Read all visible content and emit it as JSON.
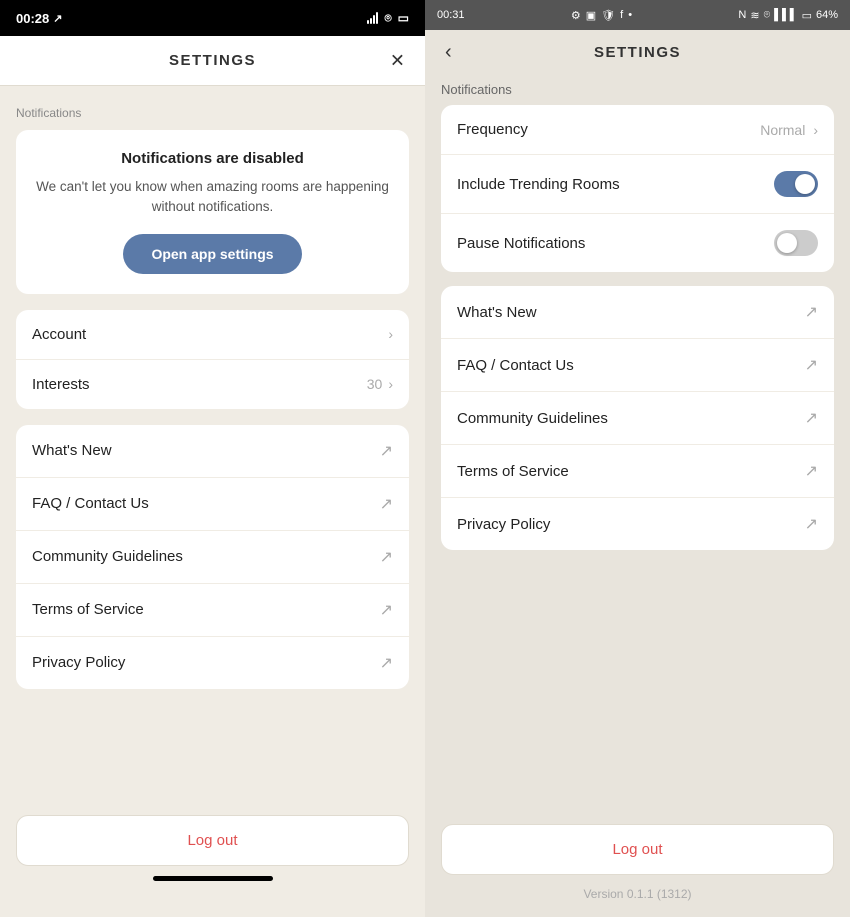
{
  "left": {
    "statusBar": {
      "time": "00:28",
      "locationIcon": "↗"
    },
    "header": {
      "title": "SETTINGS",
      "closeLabel": "✕"
    },
    "notificationsSection": {
      "label": "Notifications",
      "card": {
        "title": "Notifications are disabled",
        "description": "We can't let you know when amazing rooms are happening without notifications.",
        "buttonLabel": "Open app settings"
      }
    },
    "accountSection": {
      "items": [
        {
          "label": "Account",
          "value": "",
          "hasChevron": true
        },
        {
          "label": "Interests",
          "value": "30",
          "hasChevron": true
        }
      ]
    },
    "linksSection": {
      "items": [
        {
          "label": "What's New"
        },
        {
          "label": "FAQ / Contact Us"
        },
        {
          "label": "Community Guidelines"
        },
        {
          "label": "Terms of Service"
        },
        {
          "label": "Privacy Policy"
        }
      ]
    },
    "footer": {
      "logoutLabel": "Log out"
    }
  },
  "right": {
    "statusBar": {
      "time": "00:31",
      "batteryLevel": "64%"
    },
    "header": {
      "title": "SETTINGS",
      "backIcon": "‹"
    },
    "notificationsSection": {
      "label": "Notifications",
      "items": [
        {
          "label": "Frequency",
          "type": "value",
          "value": "Normal"
        },
        {
          "label": "Include Trending Rooms",
          "type": "toggle",
          "on": true
        },
        {
          "label": "Pause Notifications",
          "type": "toggle",
          "on": false
        }
      ]
    },
    "linksSection": {
      "items": [
        {
          "label": "What's New"
        },
        {
          "label": "FAQ / Contact Us"
        },
        {
          "label": "Community Guidelines"
        },
        {
          "label": "Terms of Service"
        },
        {
          "label": "Privacy Policy"
        }
      ]
    },
    "footer": {
      "logoutLabel": "Log out",
      "versionText": "Version 0.1.1 (1312)"
    }
  }
}
